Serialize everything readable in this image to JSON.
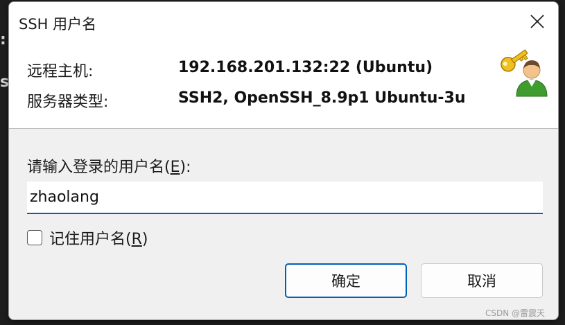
{
  "background": {
    "fragments": [
      ":",
      "s"
    ]
  },
  "dialog": {
    "title": "SSH 用户名",
    "close_icon": "close-icon",
    "info": {
      "host_label": "远程主机:",
      "host_value": "192.168.201.132:22 (Ubuntu)",
      "server_type_label": "服务器类型:",
      "server_type_value": "SSH2, OpenSSH_8.9p1 Ubuntu-3u",
      "icon": "key-user-icon"
    },
    "prompt": {
      "before": "请输入登录的用户名(",
      "hotkey": "E",
      "after": "):"
    },
    "username_input": {
      "value": "zhaolang"
    },
    "remember": {
      "checked": false,
      "before": "记住用户名(",
      "hotkey": "R",
      "after": ")"
    },
    "buttons": {
      "ok": "确定",
      "cancel": "取消"
    }
  },
  "watermark": "CSDN @雷震天"
}
